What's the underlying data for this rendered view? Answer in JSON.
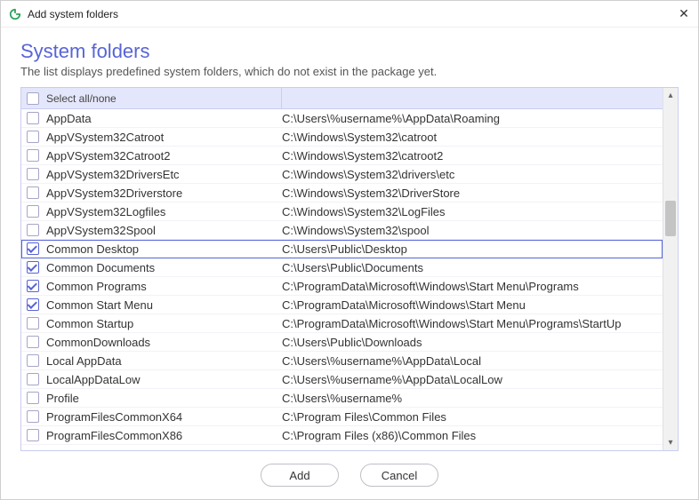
{
  "window": {
    "title": "Add system folders"
  },
  "page": {
    "heading": "System folders",
    "subtext": "The list displays predefined system folders, which do not exist in the package yet."
  },
  "header": {
    "select_all_label": "Select all/none"
  },
  "rows": [
    {
      "name": "AppData",
      "path": "C:\\Users\\%username%\\AppData\\Roaming",
      "checked": false
    },
    {
      "name": "AppVSystem32Catroot",
      "path": "C:\\Windows\\System32\\catroot",
      "checked": false
    },
    {
      "name": "AppVSystem32Catroot2",
      "path": "C:\\Windows\\System32\\catroot2",
      "checked": false
    },
    {
      "name": "AppVSystem32DriversEtc",
      "path": "C:\\Windows\\System32\\drivers\\etc",
      "checked": false
    },
    {
      "name": "AppVSystem32Driverstore",
      "path": "C:\\Windows\\System32\\DriverStore",
      "checked": false
    },
    {
      "name": "AppVSystem32Logfiles",
      "path": "C:\\Windows\\System32\\LogFiles",
      "checked": false
    },
    {
      "name": "AppVSystem32Spool",
      "path": "C:\\Windows\\System32\\spool",
      "checked": false
    },
    {
      "name": "Common Desktop",
      "path": "C:\\Users\\Public\\Desktop",
      "checked": true,
      "selected": true
    },
    {
      "name": "Common Documents",
      "path": "C:\\Users\\Public\\Documents",
      "checked": true
    },
    {
      "name": "Common Programs",
      "path": "C:\\ProgramData\\Microsoft\\Windows\\Start Menu\\Programs",
      "checked": true
    },
    {
      "name": "Common Start Menu",
      "path": "C:\\ProgramData\\Microsoft\\Windows\\Start Menu",
      "checked": true
    },
    {
      "name": "Common Startup",
      "path": "C:\\ProgramData\\Microsoft\\Windows\\Start Menu\\Programs\\StartUp",
      "checked": false
    },
    {
      "name": "CommonDownloads",
      "path": "C:\\Users\\Public\\Downloads",
      "checked": false
    },
    {
      "name": "Local AppData",
      "path": "C:\\Users\\%username%\\AppData\\Local",
      "checked": false
    },
    {
      "name": "LocalAppDataLow",
      "path": "C:\\Users\\%username%\\AppData\\LocalLow",
      "checked": false
    },
    {
      "name": "Profile",
      "path": "C:\\Users\\%username%",
      "checked": false
    },
    {
      "name": "ProgramFilesCommonX64",
      "path": "C:\\Program Files\\Common Files",
      "checked": false
    },
    {
      "name": "ProgramFilesCommonX86",
      "path": "C:\\Program Files (x86)\\Common Files",
      "checked": false
    }
  ],
  "buttons": {
    "add": "Add",
    "cancel": "Cancel"
  }
}
